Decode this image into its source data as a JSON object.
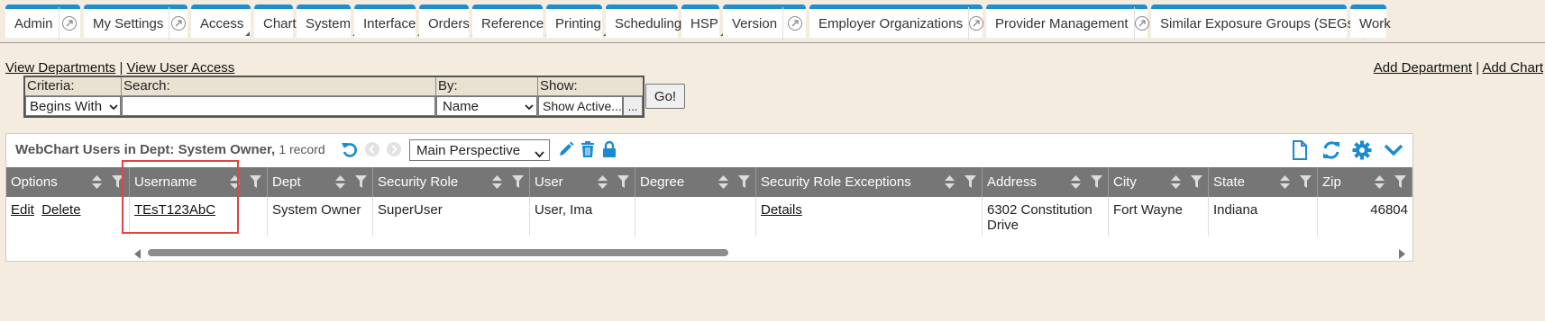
{
  "tabs": [
    {
      "label": "Admin",
      "dropdown": false,
      "external": true
    },
    {
      "label": "My Settings",
      "dropdown": false,
      "external": true
    },
    {
      "label": "Access",
      "dropdown": true,
      "external": false
    },
    {
      "label": "Chart",
      "dropdown": true,
      "external": false
    },
    {
      "label": "System",
      "dropdown": true,
      "external": false
    },
    {
      "label": "Interface",
      "dropdown": true,
      "external": false
    },
    {
      "label": "Orders",
      "dropdown": true,
      "external": false
    },
    {
      "label": "Reference",
      "dropdown": true,
      "external": false
    },
    {
      "label": "Printing",
      "dropdown": true,
      "external": false
    },
    {
      "label": "Scheduling",
      "dropdown": true,
      "external": false
    },
    {
      "label": "HSP",
      "dropdown": true,
      "external": false
    },
    {
      "label": "Version",
      "dropdown": false,
      "external": true
    },
    {
      "label": "Employer Organizations",
      "dropdown": false,
      "external": true
    },
    {
      "label": "Provider Management",
      "dropdown": false,
      "external": true
    },
    {
      "label": "Similar Exposure Groups (SEGs)",
      "dropdown": false,
      "external": true
    },
    {
      "label": "Work",
      "dropdown": false,
      "external": false
    }
  ],
  "links": {
    "view_departments": "View Departments",
    "separator": "|",
    "view_user_access": "View User Access",
    "add_department": "Add Department",
    "add_chart": "Add Chart"
  },
  "search": {
    "criteria_label": "Criteria:",
    "criteria_value": "Begins With",
    "search_label": "Search:",
    "search_value": "",
    "by_label": "By:",
    "by_value": "Name",
    "show_label": "Show:",
    "show_value": "Show Active...",
    "more_label": "...",
    "go_label": "Go!"
  },
  "grid": {
    "title": "WebChart Users in Dept: System Owner,",
    "record_count": "1 record",
    "perspective": "Main Perspective",
    "columns": [
      "Options",
      "Username",
      "Dept",
      "Security Role",
      "User",
      "Degree",
      "Security Role Exceptions",
      "Address",
      "City",
      "State",
      "Zip"
    ],
    "rows": [
      {
        "edit": "Edit",
        "delete": "Delete",
        "username": "TEsT123AbC",
        "dept": "System Owner",
        "security_role": "SuperUser",
        "user": "User, Ima",
        "degree": "",
        "exceptions": "Details",
        "address": "6302 Constitution Drive",
        "city": "Fort Wayne",
        "state": "Indiana",
        "zip": "46804"
      }
    ]
  },
  "colors": {
    "tab_accent": "#1d8fd0",
    "header_bg": "#767676",
    "page_bg": "#f3ecdf",
    "icon_blue": "#1a8bd0",
    "highlight": "#e04545"
  }
}
